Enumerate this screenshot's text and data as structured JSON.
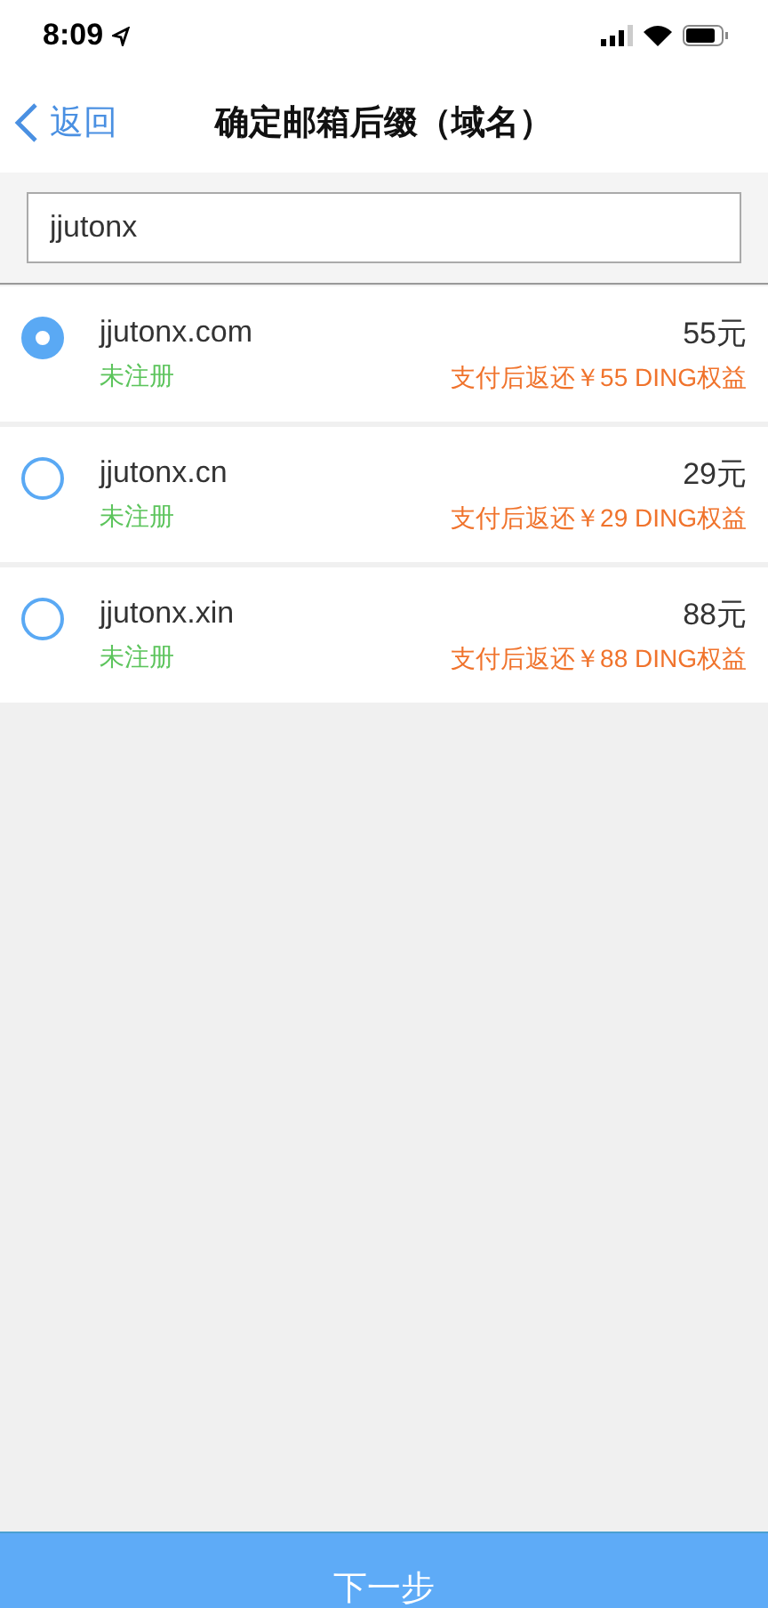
{
  "status_bar": {
    "time": "8:09"
  },
  "nav": {
    "back": "返回",
    "title": "确定邮箱后缀（域名）"
  },
  "search": {
    "value": "jjutonx"
  },
  "domains": [
    {
      "name": "jjutonx.com",
      "status": "未注册",
      "price": "55元",
      "rebate": "支付后返还￥55 DING权益",
      "selected": true
    },
    {
      "name": "jjutonx.cn",
      "status": "未注册",
      "price": "29元",
      "rebate": "支付后返还￥29 DING权益",
      "selected": false
    },
    {
      "name": "jjutonx.xin",
      "status": "未注册",
      "price": "88元",
      "rebate": "支付后返还￥88 DING权益",
      "selected": false
    }
  ],
  "next_button": "下一步"
}
